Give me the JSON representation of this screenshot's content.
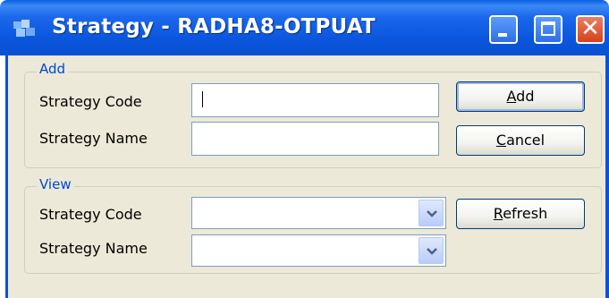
{
  "window": {
    "title": "Strategy - RADHA8-OTPUAT",
    "controls": {
      "minimize_icon": "minimize-icon",
      "maximize_icon": "maximize-icon",
      "close_glyph": "✕"
    },
    "colors": {
      "titlebar": "#0b51d2",
      "legend": "#0046d5",
      "client": "#ece9d8"
    }
  },
  "add_group": {
    "legend": "Add",
    "code_label": "Strategy Code",
    "name_label": "Strategy Name",
    "code_value": "",
    "name_value": "",
    "add_button": {
      "accel": "A",
      "rest": "dd"
    },
    "cancel_button": {
      "accel": "C",
      "rest": "ancel"
    }
  },
  "view_group": {
    "legend": "View",
    "code_label": "Strategy Code",
    "name_label": "Strategy Name",
    "code_selected": "",
    "name_selected": "",
    "refresh_button": {
      "accel": "R",
      "rest": "efresh"
    }
  }
}
